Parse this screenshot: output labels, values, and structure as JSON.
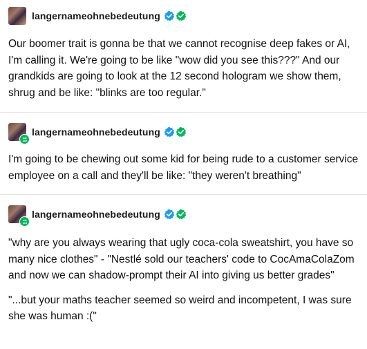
{
  "posts": [
    {
      "username": "langernameohnebedeutung",
      "is_reblog": false,
      "paragraphs": [
        "Our boomer trait is gonna be that we cannot recognise deep fakes or AI, I'm calling it. We're going to be like \"wow did you see this???\" And our grandkids are going to look at the 12 second hologram we show them, shrug and be like: \"blinks are too regular.\""
      ]
    },
    {
      "username": "langernameohnebedeutung",
      "is_reblog": true,
      "paragraphs": [
        "I'm going to be chewing out some kid for being rude to a customer service employee on a call and they'll be like: \"they weren't breathing\""
      ]
    },
    {
      "username": "langernameohnebedeutung",
      "is_reblog": true,
      "paragraphs": [
        "\"why are you always wearing that ugly coca-cola sweatshirt, you have so many nice clothes\" - \"Nestlé sold our teachers' code to CocAmaColaZom and now we can shadow-prompt their AI into giving us better grades\"",
        "\"...but your maths teacher seemed so weird and incompetent, I was sure she was human :(\""
      ]
    }
  ],
  "icons": {
    "verified_blue": "verified-blue-icon",
    "verified_green": "verified-green-icon",
    "reblog": "reblog-icon"
  },
  "colors": {
    "verified_blue": "#1d9bf0",
    "verified_green": "#00b85c",
    "divider": "#e3e3e3"
  }
}
